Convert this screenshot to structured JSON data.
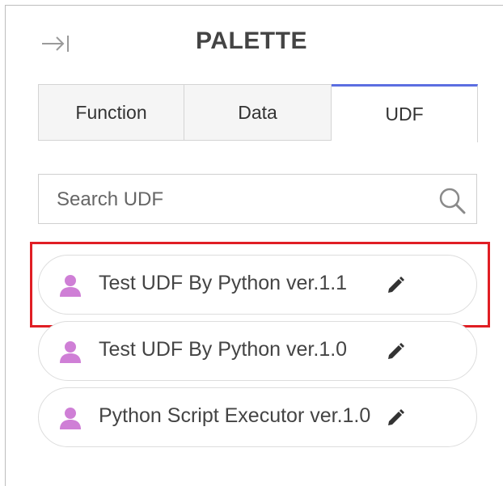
{
  "palette": {
    "title": "PALETTE",
    "collapse_icon": "collapse-right-icon"
  },
  "tabs": [
    {
      "label": "Function",
      "active": false
    },
    {
      "label": "Data",
      "active": false
    },
    {
      "label": "UDF",
      "active": true
    }
  ],
  "search": {
    "placeholder": "Search UDF",
    "value": "",
    "icon": "search-icon"
  },
  "udf_items": [
    {
      "label": "Test UDF By Python ver.1.1",
      "icon": "user-icon",
      "action_icon": "edit-icon",
      "highlighted": true
    },
    {
      "label": "Test UDF By Python ver.1.0",
      "icon": "user-icon",
      "action_icon": "edit-icon",
      "highlighted": false
    },
    {
      "label": "Python Script Executor ver.1.0",
      "icon": "user-icon",
      "action_icon": "edit-icon",
      "highlighted": false
    }
  ],
  "colors": {
    "accent_tab": "#5b6ee1",
    "user_icon": "#cf7fd6",
    "highlight_border": "#e01e24"
  }
}
